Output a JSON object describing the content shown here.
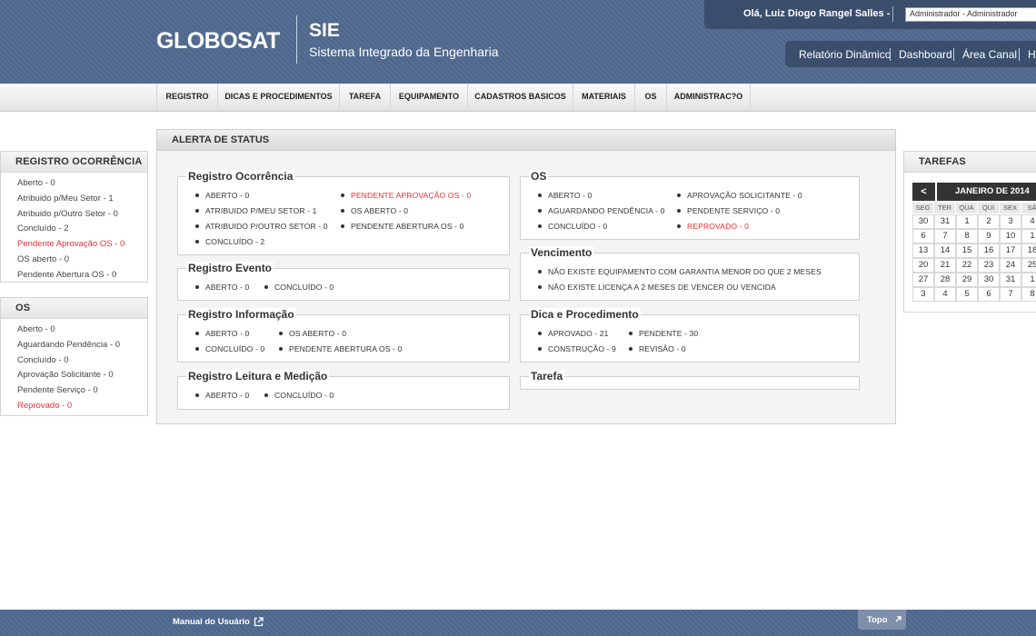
{
  "header": {
    "logo": "GLOBOSAT",
    "app_title": "SIE",
    "app_subtitle": "Sistema Integrado da Engenharia",
    "greeting": "Olá, Luiz Diogo Rangel Salles -",
    "role_selected": "Administrador - Administrador",
    "nav": [
      "Relatório Dinâmico",
      "Dashboard",
      "Área Canal",
      "H"
    ]
  },
  "menu": [
    "REGISTRO",
    "DICAS E PROCEDIMENTOS",
    "TAREFA",
    "EQUIPAMENTO",
    "CADASTROS BASICOS",
    "MATERIAIS",
    "OS",
    "ADMINISTRAC?O"
  ],
  "left_registro": {
    "title": "REGISTRO OCORRÊNCIA",
    "items": [
      "Aberto - 0",
      "Atribuido p/Meu Setor - 1",
      "Atribuido p/Outro Setor - 0",
      "Concluído - 2",
      "Pendente Aprovação OS - 0",
      "OS aberto - 0",
      "Pendente Abertura OS - 0"
    ]
  },
  "left_os": {
    "title": "OS",
    "items": [
      "Aberto - 0",
      "Aguardando Pendência - 0",
      "Concluído - 0",
      "Aprovação Solicitante - 0",
      "Pendente Serviço - 0",
      "Reprovado - 0"
    ]
  },
  "status": {
    "title": "ALERTA DE STATUS",
    "registro_ocorrencia": {
      "title": "Registro Ocorrência",
      "items": [
        "ABERTO - 0",
        "ATRIBUIDO P/MEU SETOR - 1",
        "ATRIBUIDO P/OUTRO SETOR - 0",
        "CONCLUÍDO - 2",
        "PENDENTE APROVAÇÃO OS - 0",
        "OS ABERTO - 0",
        "PENDENTE ABERTURA OS - 0"
      ]
    },
    "registro_evento": {
      "title": "Registro Evento",
      "items": [
        "ABERTO - 0",
        "CONCLUÍDO - 0"
      ]
    },
    "registro_informacao": {
      "title": "Registro Informação",
      "items": [
        "ABERTO - 0",
        "CONCLUÍDO - 0",
        "OS ABERTO - 0",
        "PENDENTE ABERTURA OS - 0"
      ]
    },
    "registro_leitura": {
      "title": "Registro Leitura e Medição",
      "items": [
        "ABERTO - 0",
        "CONCLUÍDO - 0"
      ]
    },
    "os": {
      "title": "OS",
      "items": [
        "ABERTO - 0",
        "AGUARDANDO PENDÊNCIA - 0",
        "CONCLUÍDO - 0",
        "APROVAÇÃO SOLICITANTE - 0",
        "PENDENTE SERVIÇO - 0",
        "REPROVADO - 0"
      ]
    },
    "vencimento": {
      "title": "Vencimento",
      "items": [
        "NÃO EXISTE EQUIPAMENTO COM GARANTIA MENOR DO QUE 2 MESES",
        "NÃO EXISTE LICENÇA A 2 MESES DE VENCER OU VENCIDA"
      ]
    },
    "dica": {
      "title": "Dica e Procedimento",
      "items": [
        "APROVADO - 21",
        "CONSTRUÇÃO - 9",
        "PENDENTE - 30",
        "REVISÃO - 0"
      ]
    },
    "tarefa": {
      "title": "Tarefa"
    }
  },
  "tarefas": {
    "title": "TAREFAS",
    "prev": "<",
    "month": "JANEIRO DE 2014",
    "dow": [
      "SEG",
      "TER",
      "QUA",
      "QUI",
      "SEX",
      "SÁ"
    ],
    "weeks": [
      [
        "30",
        "31",
        "1",
        "2",
        "3",
        "4"
      ],
      [
        "6",
        "7",
        "8",
        "9",
        "10",
        "1"
      ],
      [
        "13",
        "14",
        "15",
        "16",
        "17",
        "18"
      ],
      [
        "20",
        "21",
        "22",
        "23",
        "24",
        "25"
      ],
      [
        "27",
        "28",
        "29",
        "30",
        "31",
        "1"
      ],
      [
        "3",
        "4",
        "5",
        "6",
        "7",
        "8"
      ]
    ]
  },
  "footer": {
    "manual": "Manual do Usuário",
    "topo": "Topo"
  },
  "colors": {
    "header": "#566f94",
    "alert_red": "#e53030"
  }
}
